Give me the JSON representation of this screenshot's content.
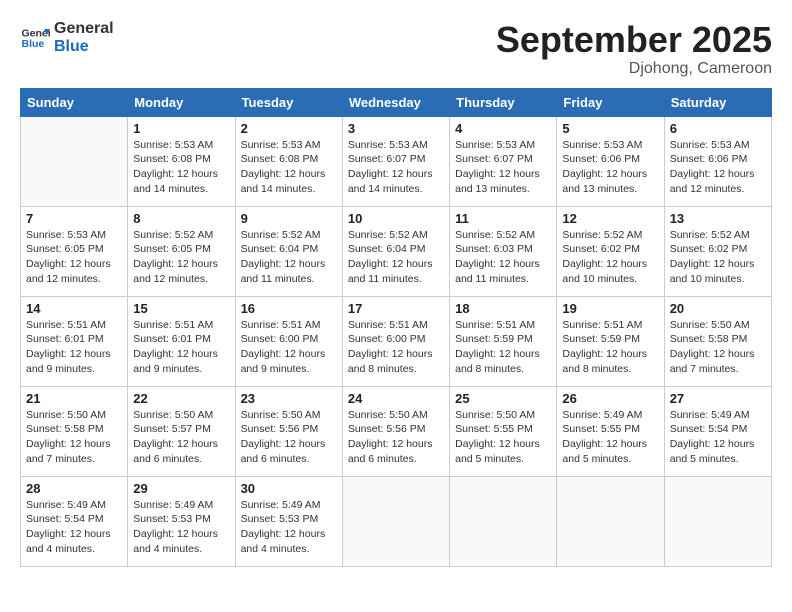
{
  "header": {
    "logo_line1": "General",
    "logo_line2": "Blue",
    "month": "September 2025",
    "location": "Djohong, Cameroon"
  },
  "days": [
    "Sunday",
    "Monday",
    "Tuesday",
    "Wednesday",
    "Thursday",
    "Friday",
    "Saturday"
  ],
  "weeks": [
    [
      {
        "date": "",
        "info": ""
      },
      {
        "date": "1",
        "info": "Sunrise: 5:53 AM\nSunset: 6:08 PM\nDaylight: 12 hours\nand 14 minutes."
      },
      {
        "date": "2",
        "info": "Sunrise: 5:53 AM\nSunset: 6:08 PM\nDaylight: 12 hours\nand 14 minutes."
      },
      {
        "date": "3",
        "info": "Sunrise: 5:53 AM\nSunset: 6:07 PM\nDaylight: 12 hours\nand 14 minutes."
      },
      {
        "date": "4",
        "info": "Sunrise: 5:53 AM\nSunset: 6:07 PM\nDaylight: 12 hours\nand 13 minutes."
      },
      {
        "date": "5",
        "info": "Sunrise: 5:53 AM\nSunset: 6:06 PM\nDaylight: 12 hours\nand 13 minutes."
      },
      {
        "date": "6",
        "info": "Sunrise: 5:53 AM\nSunset: 6:06 PM\nDaylight: 12 hours\nand 12 minutes."
      }
    ],
    [
      {
        "date": "7",
        "info": "Sunrise: 5:53 AM\nSunset: 6:05 PM\nDaylight: 12 hours\nand 12 minutes."
      },
      {
        "date": "8",
        "info": "Sunrise: 5:52 AM\nSunset: 6:05 PM\nDaylight: 12 hours\nand 12 minutes."
      },
      {
        "date": "9",
        "info": "Sunrise: 5:52 AM\nSunset: 6:04 PM\nDaylight: 12 hours\nand 11 minutes."
      },
      {
        "date": "10",
        "info": "Sunrise: 5:52 AM\nSunset: 6:04 PM\nDaylight: 12 hours\nand 11 minutes."
      },
      {
        "date": "11",
        "info": "Sunrise: 5:52 AM\nSunset: 6:03 PM\nDaylight: 12 hours\nand 11 minutes."
      },
      {
        "date": "12",
        "info": "Sunrise: 5:52 AM\nSunset: 6:02 PM\nDaylight: 12 hours\nand 10 minutes."
      },
      {
        "date": "13",
        "info": "Sunrise: 5:52 AM\nSunset: 6:02 PM\nDaylight: 12 hours\nand 10 minutes."
      }
    ],
    [
      {
        "date": "14",
        "info": "Sunrise: 5:51 AM\nSunset: 6:01 PM\nDaylight: 12 hours\nand 9 minutes."
      },
      {
        "date": "15",
        "info": "Sunrise: 5:51 AM\nSunset: 6:01 PM\nDaylight: 12 hours\nand 9 minutes."
      },
      {
        "date": "16",
        "info": "Sunrise: 5:51 AM\nSunset: 6:00 PM\nDaylight: 12 hours\nand 9 minutes."
      },
      {
        "date": "17",
        "info": "Sunrise: 5:51 AM\nSunset: 6:00 PM\nDaylight: 12 hours\nand 8 minutes."
      },
      {
        "date": "18",
        "info": "Sunrise: 5:51 AM\nSunset: 5:59 PM\nDaylight: 12 hours\nand 8 minutes."
      },
      {
        "date": "19",
        "info": "Sunrise: 5:51 AM\nSunset: 5:59 PM\nDaylight: 12 hours\nand 8 minutes."
      },
      {
        "date": "20",
        "info": "Sunrise: 5:50 AM\nSunset: 5:58 PM\nDaylight: 12 hours\nand 7 minutes."
      }
    ],
    [
      {
        "date": "21",
        "info": "Sunrise: 5:50 AM\nSunset: 5:58 PM\nDaylight: 12 hours\nand 7 minutes."
      },
      {
        "date": "22",
        "info": "Sunrise: 5:50 AM\nSunset: 5:57 PM\nDaylight: 12 hours\nand 6 minutes."
      },
      {
        "date": "23",
        "info": "Sunrise: 5:50 AM\nSunset: 5:56 PM\nDaylight: 12 hours\nand 6 minutes."
      },
      {
        "date": "24",
        "info": "Sunrise: 5:50 AM\nSunset: 5:56 PM\nDaylight: 12 hours\nand 6 minutes."
      },
      {
        "date": "25",
        "info": "Sunrise: 5:50 AM\nSunset: 5:55 PM\nDaylight: 12 hours\nand 5 minutes."
      },
      {
        "date": "26",
        "info": "Sunrise: 5:49 AM\nSunset: 5:55 PM\nDaylight: 12 hours\nand 5 minutes."
      },
      {
        "date": "27",
        "info": "Sunrise: 5:49 AM\nSunset: 5:54 PM\nDaylight: 12 hours\nand 5 minutes."
      }
    ],
    [
      {
        "date": "28",
        "info": "Sunrise: 5:49 AM\nSunset: 5:54 PM\nDaylight: 12 hours\nand 4 minutes."
      },
      {
        "date": "29",
        "info": "Sunrise: 5:49 AM\nSunset: 5:53 PM\nDaylight: 12 hours\nand 4 minutes."
      },
      {
        "date": "30",
        "info": "Sunrise: 5:49 AM\nSunset: 5:53 PM\nDaylight: 12 hours\nand 4 minutes."
      },
      {
        "date": "",
        "info": ""
      },
      {
        "date": "",
        "info": ""
      },
      {
        "date": "",
        "info": ""
      },
      {
        "date": "",
        "info": ""
      }
    ]
  ]
}
